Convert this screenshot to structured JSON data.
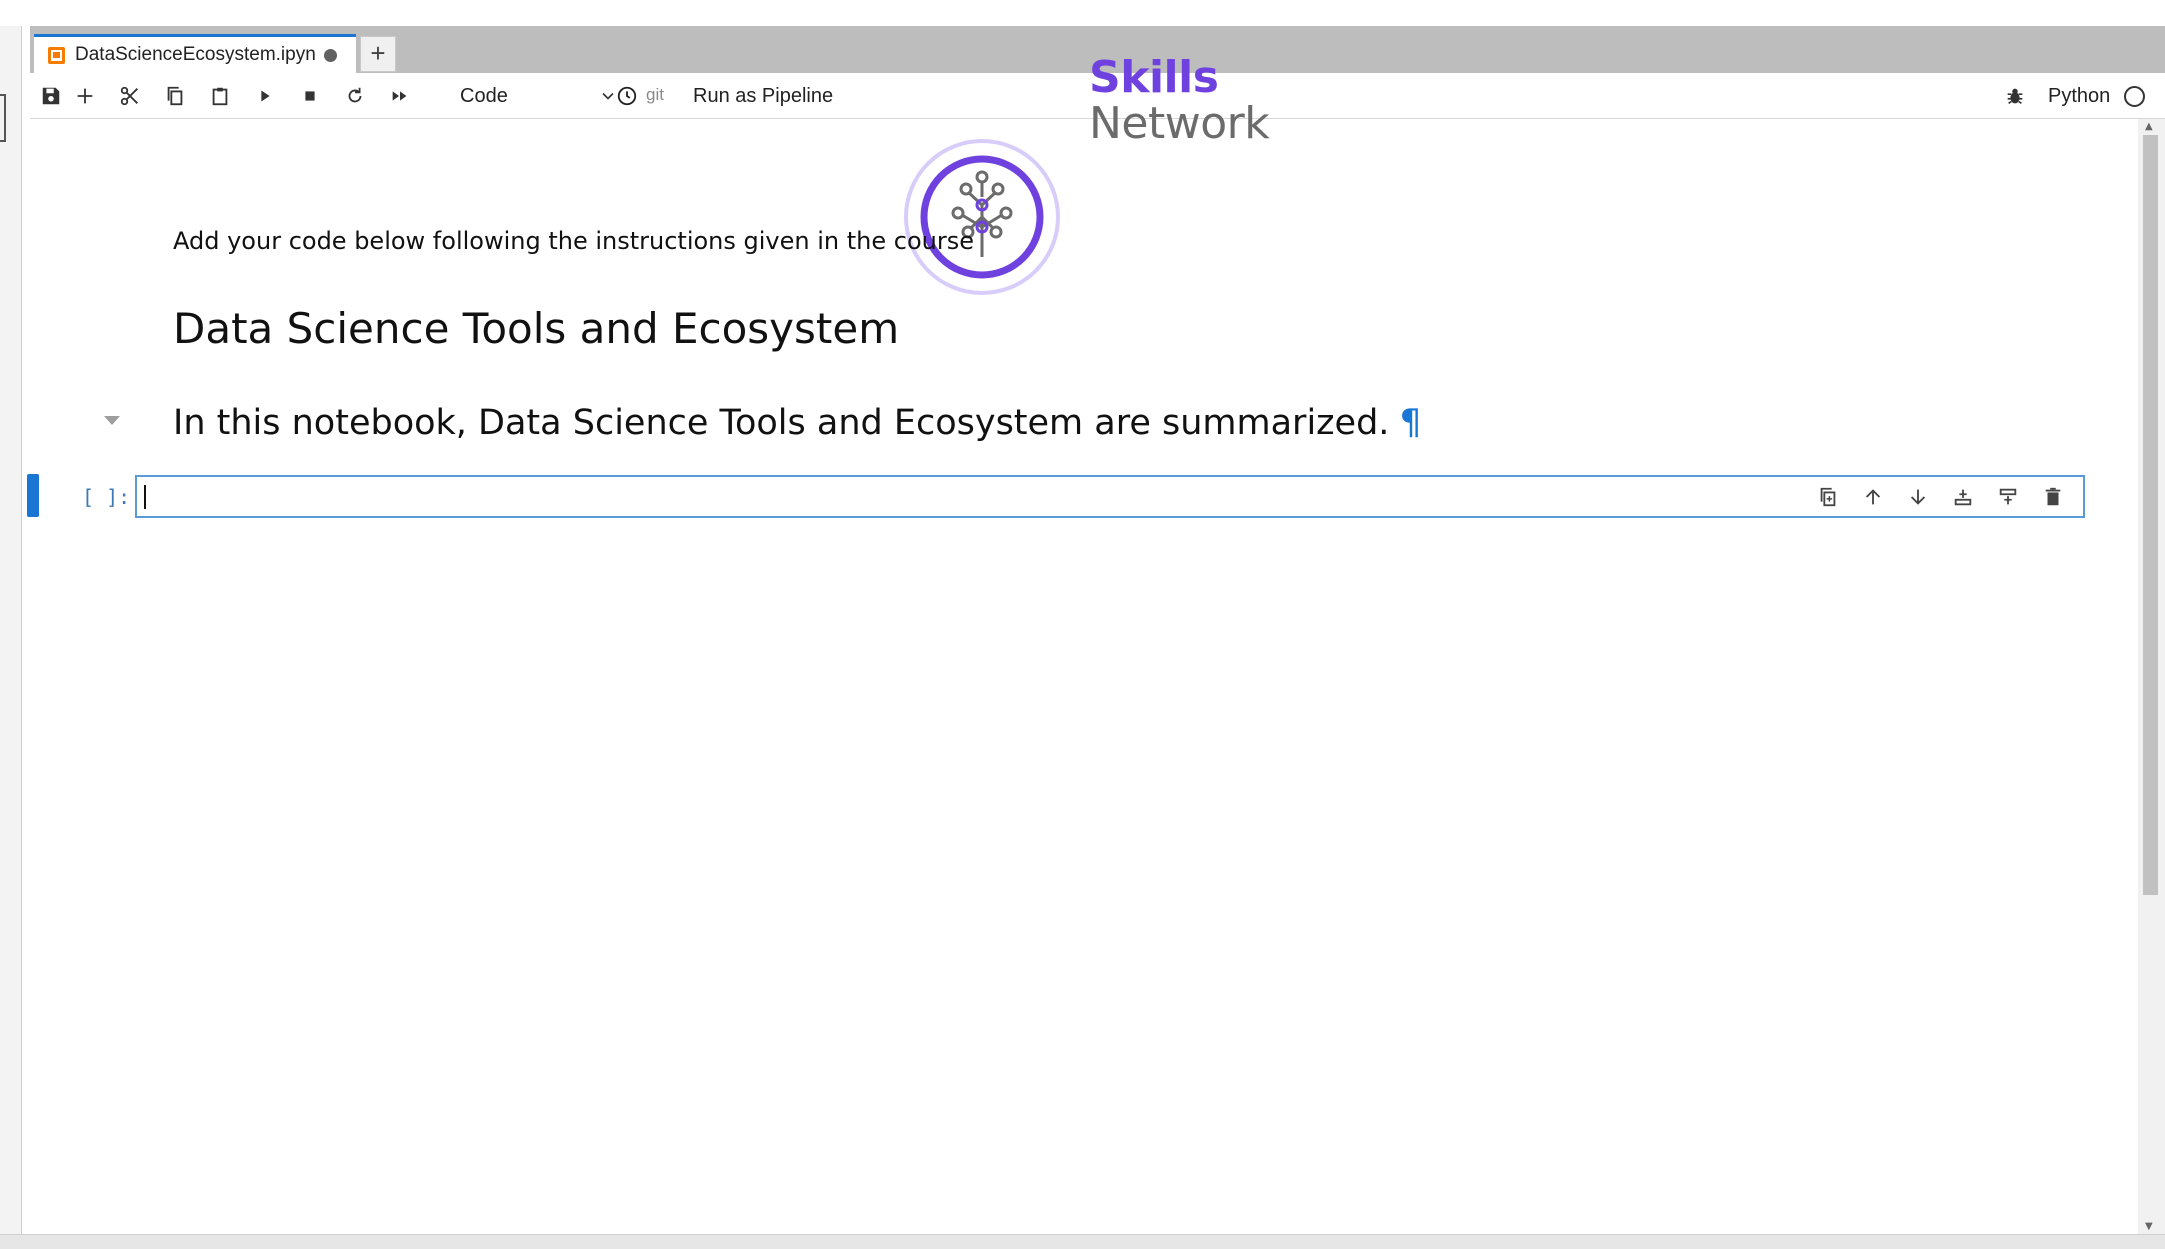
{
  "tab": {
    "title": "DataScienceEcosystem.ipyn",
    "new_tab": "+"
  },
  "toolbar": {
    "cell_type": "Code",
    "git": "git",
    "run_pipeline": "Run as Pipeline",
    "kernel_name": "Python"
  },
  "logo": {
    "line1": "Skills",
    "line2": "Network",
    "accent": "#6f42e0"
  },
  "cells": {
    "intro": "Add your code below following the instructions given in the course",
    "title": "Data Science Tools and Ecosystem",
    "summary": "In this notebook, Data Science Tools and Ecosystem are summarized.",
    "anchor": "¶",
    "prompt": "[ ]:"
  },
  "colors": {
    "brand_blue": "#1976d2",
    "tab_orange": "#f57c00"
  },
  "icons": {
    "toolbar": [
      "save-icon",
      "add-cell-icon",
      "cut-icon",
      "copy-icon",
      "paste-icon",
      "run-icon",
      "stop-icon",
      "restart-icon",
      "run-all-icon",
      "clock-icon",
      "bug-icon"
    ],
    "cell": [
      "duplicate-icon",
      "move-up-icon",
      "move-down-icon",
      "insert-below-icon",
      "insert-above-icon",
      "delete-icon"
    ]
  }
}
